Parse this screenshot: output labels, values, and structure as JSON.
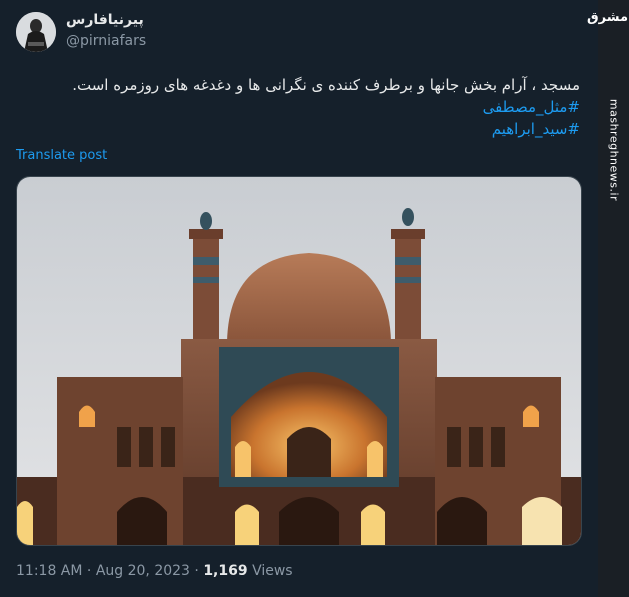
{
  "tweet": {
    "display_name": "پیرنیافارس",
    "handle": "@pirniafars",
    "text": "مسجد ، آرام بخش جانها و برطرف کننده ی نگرانی ها و دغدغه های روزمره است.",
    "hashtags": [
      "#مثل_مصطفی",
      "#سید_ابراهیم"
    ],
    "translate_label": "Translate post",
    "time": "11:18 AM",
    "date": "Aug 20, 2023",
    "views_count": "1,169",
    "views_label": "Views",
    "separator": "·"
  },
  "watermark": {
    "logo_text": "مشرق",
    "url": "mashreghnews.ir"
  },
  "colors": {
    "background": "#15202b",
    "link": "#1d9bf0",
    "muted": "#8b98a5"
  }
}
